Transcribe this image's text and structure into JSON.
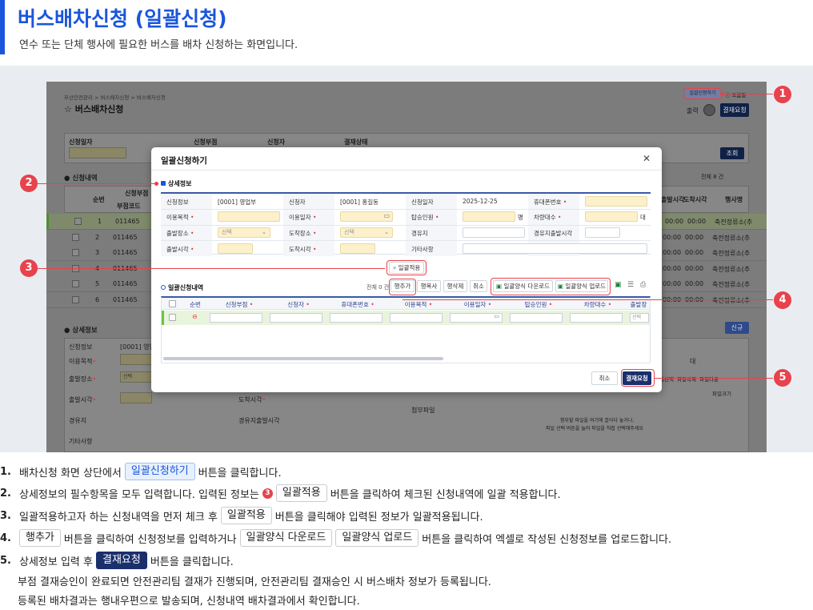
{
  "header": {
    "title": "버스배차신청 (일괄신청)",
    "description": "연수 또는 단체 행사에 필요한 버스를 배차 신청하는 화면입니다."
  },
  "background_screen": {
    "breadcrumb": "부산안전관리 > 버스배차신청 > 버스배차신청",
    "title": "버스배차신청",
    "top_buttons": [
      "일괄신청하기",
      "도움말"
    ],
    "action_buttons": [
      "출력",
      "결재요청"
    ],
    "search_labels": [
      "신청일자",
      "신청부점",
      "신청자",
      "결재상태"
    ],
    "search_button": "조회",
    "list_title": "신청내역",
    "list_count_text": "전체 8 건",
    "list_headers": [
      "순번",
      "신청부점",
      "부점코드",
      "출발시각",
      "도착시각",
      "행사명"
    ],
    "rows": [
      {
        "no": "1",
        "code": "011465",
        "dep": "00:00",
        "arr": "00:00",
        "name": "축전정류소(추"
      },
      {
        "no": "2",
        "code": "011465",
        "dep": "00:00",
        "arr": "00:00",
        "name": "축전정류소(추"
      },
      {
        "no": "3",
        "code": "011465",
        "dep": "00:00",
        "arr": "00:00",
        "name": "축전정류소(추"
      },
      {
        "no": "4",
        "code": "011465",
        "dep": "00:00",
        "arr": "00:00",
        "name": "축전정류소(추"
      },
      {
        "no": "5",
        "code": "011465",
        "dep": "00:00",
        "arr": "00:00",
        "name": "축전정류소(추"
      },
      {
        "no": "6",
        "code": "011465",
        "dep": "00:00",
        "arr": "00:00",
        "name": "축전정류소(추"
      }
    ],
    "detail_title": "상세정보",
    "detail_new_button": "신규",
    "detail_labels": [
      "신청정보",
      "이용목적",
      "출발장소",
      "출발시각",
      "경유지",
      "기타사항"
    ],
    "detail_value": "[0001] 영업",
    "detail_other": {
      "arrive_time": "도착시각",
      "via_time": "경유지출발시각",
      "unit": "대",
      "attach": "첨부파일",
      "file_size": "파일크기",
      "attach_hint1": "첨부할 파일을 여기에 끌어다 놓거나,",
      "attach_hint2": "파일 선택 버튼을 눌러 파일을 직접 선택해주세요",
      "file_buttons": [
        "파일선택",
        "파일삭제",
        "파일다운"
      ],
      "select_placeholder": "선택"
    }
  },
  "modal": {
    "title": "일괄신청하기",
    "close_icon": "close-icon",
    "detail_section": "상세정보",
    "fields": {
      "apply_info_label": "신청정보",
      "apply_info_value": "[0001] 영업부",
      "applicant_label": "신청자",
      "applicant_value": "[0001] 홍길동",
      "apply_date_label": "신청일자",
      "apply_date_value": "2025-12-25",
      "phone_label": "휴대폰번호",
      "purpose_label": "이용목적",
      "use_date_label": "이용일자",
      "passengers_label": "탑승인원",
      "passengers_unit": "명",
      "vehicles_label": "차량대수",
      "vehicles_unit": "대",
      "depart_place_label": "출발장소",
      "arrive_place_label": "도착장소",
      "via_label": "경유지",
      "via_depart_label": "경유지출발시각",
      "depart_time_label": "출발시각",
      "arrive_time_label": "도착시각",
      "other_label": "기타사항",
      "select_placeholder": "선택"
    },
    "apply_button": "일괄적용",
    "list_section": "일괄신청내역",
    "list_count": "전체 0 건",
    "list_buttons": [
      "행추가",
      "행복사",
      "행삭제",
      "취소"
    ],
    "excel_download": "일괄양식 다운로드",
    "excel_upload": "일괄양식 업로드",
    "table_headers": [
      "순번",
      "신청부점",
      "신청자",
      "휴대폰번호",
      "이용목적",
      "이용일자",
      "탑승인원",
      "차량대수",
      "출발장"
    ],
    "footer_buttons": {
      "cancel": "취소",
      "submit": "결재요청"
    }
  },
  "callouts": [
    "1",
    "2",
    "3",
    "4",
    "5"
  ],
  "steps": [
    {
      "num": "1.",
      "pre": "배차신청 화면 상단에서",
      "chip": "일괄신청하기",
      "post": "버튼을 클릭합니다."
    },
    {
      "num": "2.",
      "pre": "상세정보의 필수항목을 모두 입력합니다. 입력된 정보는",
      "badge": "3",
      "chip": "일괄적용",
      "post": "버튼을 클릭하여 체크된 신청내역에 일괄 적용합니다."
    },
    {
      "num": "3.",
      "pre": "일괄적용하고자 하는 신청내역을 먼저 체크 후",
      "chip": "일괄적용",
      "post": "버튼을 클릭해야 입력된 정보가 일괄적용됩니다."
    },
    {
      "num": "4.",
      "chip1": "행추가",
      "mid1": "버튼을 클릭하여 신청정보를 입력하거나",
      "chip2": "일괄양식 다운로드",
      "chip3": "일괄양식 업로드",
      "post": "버튼을 클릭하여 엑셀로 작성된 신청정보를 업로드합니다."
    },
    {
      "num": "5.",
      "pre": "상세정보 입력 후",
      "chip": "결재요청",
      "post": "버튼을 클릭합니다.",
      "line2": "부점 결재승인이 완료되면 안전관리팀 결재가 진행되며, 안전관리팀 결재승인 시 버스배차 정보가 등록됩니다.",
      "line3": "등록된 배차결과는 행내우편으로 발송되며, 신청내역 배차결과에서 확인합니다."
    }
  ],
  "colors": {
    "accent": "#1a56db",
    "callout": "#e8424c",
    "navy": "#1a2f6b"
  }
}
